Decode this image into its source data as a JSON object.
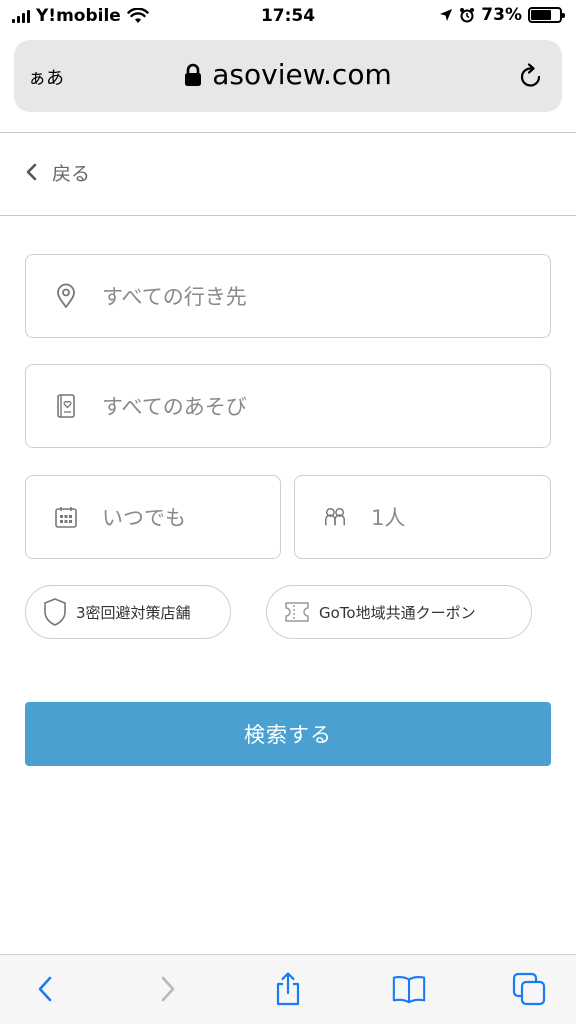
{
  "status_bar": {
    "carrier": "Y!mobile",
    "time": "17:54",
    "battery": "73%",
    "battery_level": 0.73
  },
  "browser": {
    "text_size_label": "ぁあ",
    "url": "asoview.com",
    "icons": [
      "lock-icon",
      "reload-icon"
    ]
  },
  "nav": {
    "back_label": "戻る"
  },
  "search": {
    "destination_placeholder": "すべての行き先",
    "activity_placeholder": "すべてのあそび",
    "date_placeholder": "いつでも",
    "people_value": "1人",
    "icons": [
      "location-pin-icon",
      "book-heart-icon",
      "calendar-icon",
      "people-icon"
    ]
  },
  "chips": {
    "covid_label": "3密回避対策店舗",
    "goto_label": "GoTo地域共通クーポン"
  },
  "search_button_label": "検索する",
  "colors": {
    "accent": "#4aa0d1",
    "border": "#cfcfcf",
    "placeholder": "#8a8a8a",
    "toolbar_icon": "#1a7cf5"
  },
  "toolbar": {
    "icons": [
      "back-icon",
      "forward-icon",
      "share-icon",
      "bookmarks-icon",
      "tabs-icon"
    ]
  }
}
